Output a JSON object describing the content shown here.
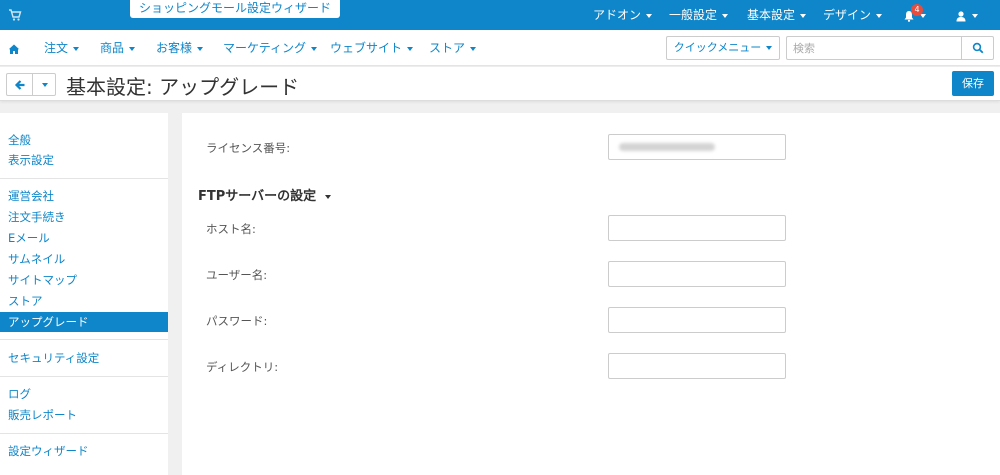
{
  "topbar": {
    "wizard_label": "ショッピングモール設定ウィザード",
    "menus": [
      "アドオン",
      "一般設定",
      "基本設定",
      "デザイン"
    ],
    "notification_count": "4"
  },
  "nav": {
    "items": [
      "注文",
      "商品",
      "お客様",
      "マーケティング",
      "ウェブサイト",
      "ストア"
    ],
    "quick_menu_label": "クイックメニュー",
    "search_placeholder": "検索"
  },
  "page": {
    "title": "基本設定: アップグレード",
    "save_label": "保存"
  },
  "sidebar": {
    "items": [
      "全般",
      "表示設定",
      "運営会社",
      "注文手続き",
      "Eメール",
      "サムネイル",
      "サイトマップ",
      "ストア",
      "アップグレード",
      "セキュリティ設定",
      "ログ",
      "販売レポート",
      "設定ウィザード"
    ],
    "active_label": "アップグレード"
  },
  "form": {
    "license_label": "ライセンス番号:",
    "ftp_section_title": "FTPサーバーの設定",
    "fields": [
      {
        "label": "ホスト名:",
        "value": ""
      },
      {
        "label": "ユーザー名:",
        "value": ""
      },
      {
        "label": "パスワード:",
        "value": ""
      },
      {
        "label": "ディレクトリ:",
        "value": ""
      }
    ]
  },
  "colors": {
    "accent": "#0e86c9",
    "badge": "#e74c3c"
  }
}
